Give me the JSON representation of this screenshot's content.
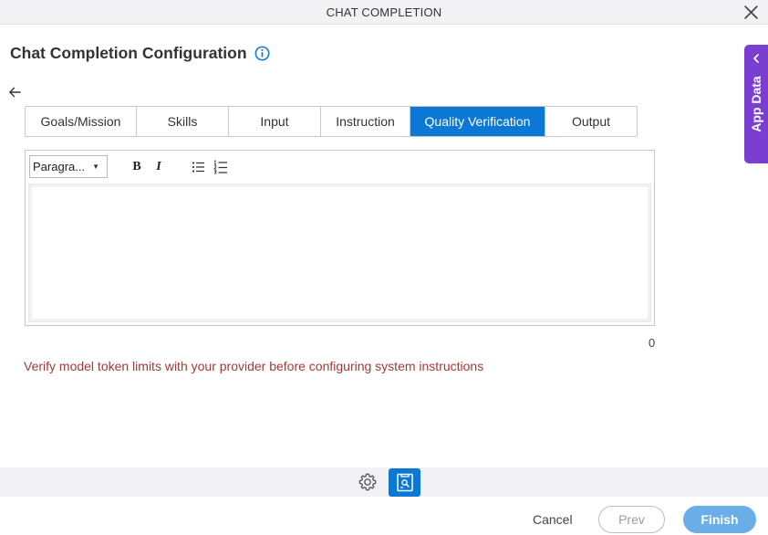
{
  "window": {
    "title": "CHAT COMPLETION"
  },
  "page": {
    "title": "Chat Completion Configuration"
  },
  "tabs": [
    {
      "label": "Goals/Mission",
      "active": false
    },
    {
      "label": "Skills",
      "active": false
    },
    {
      "label": "Input",
      "active": false
    },
    {
      "label": "Instruction",
      "active": false
    },
    {
      "label": "Quality Verification",
      "active": true
    },
    {
      "label": "Output",
      "active": false
    }
  ],
  "editor": {
    "format_select": "Paragra...",
    "bold_label": "B",
    "italic_label": "I",
    "content": "",
    "char_count": "0"
  },
  "warning": {
    "text": "Verify model token limits with your provider before configuring system instructions"
  },
  "side_panel": {
    "label": "App Data"
  },
  "footer": {
    "cancel_label": "Cancel",
    "prev_label": "Prev",
    "finish_label": "Finish"
  },
  "colors": {
    "accent": "#0a78d4",
    "app_data": "#7a3fd1",
    "warning": "#a33a3a",
    "finish_disabled": "#6aaee7"
  },
  "icons": {
    "close": "close-icon",
    "info": "info-icon",
    "back": "arrow-left-icon",
    "chevron": "chevron-left-icon",
    "gear": "gear-icon",
    "doc": "document-search-icon"
  }
}
